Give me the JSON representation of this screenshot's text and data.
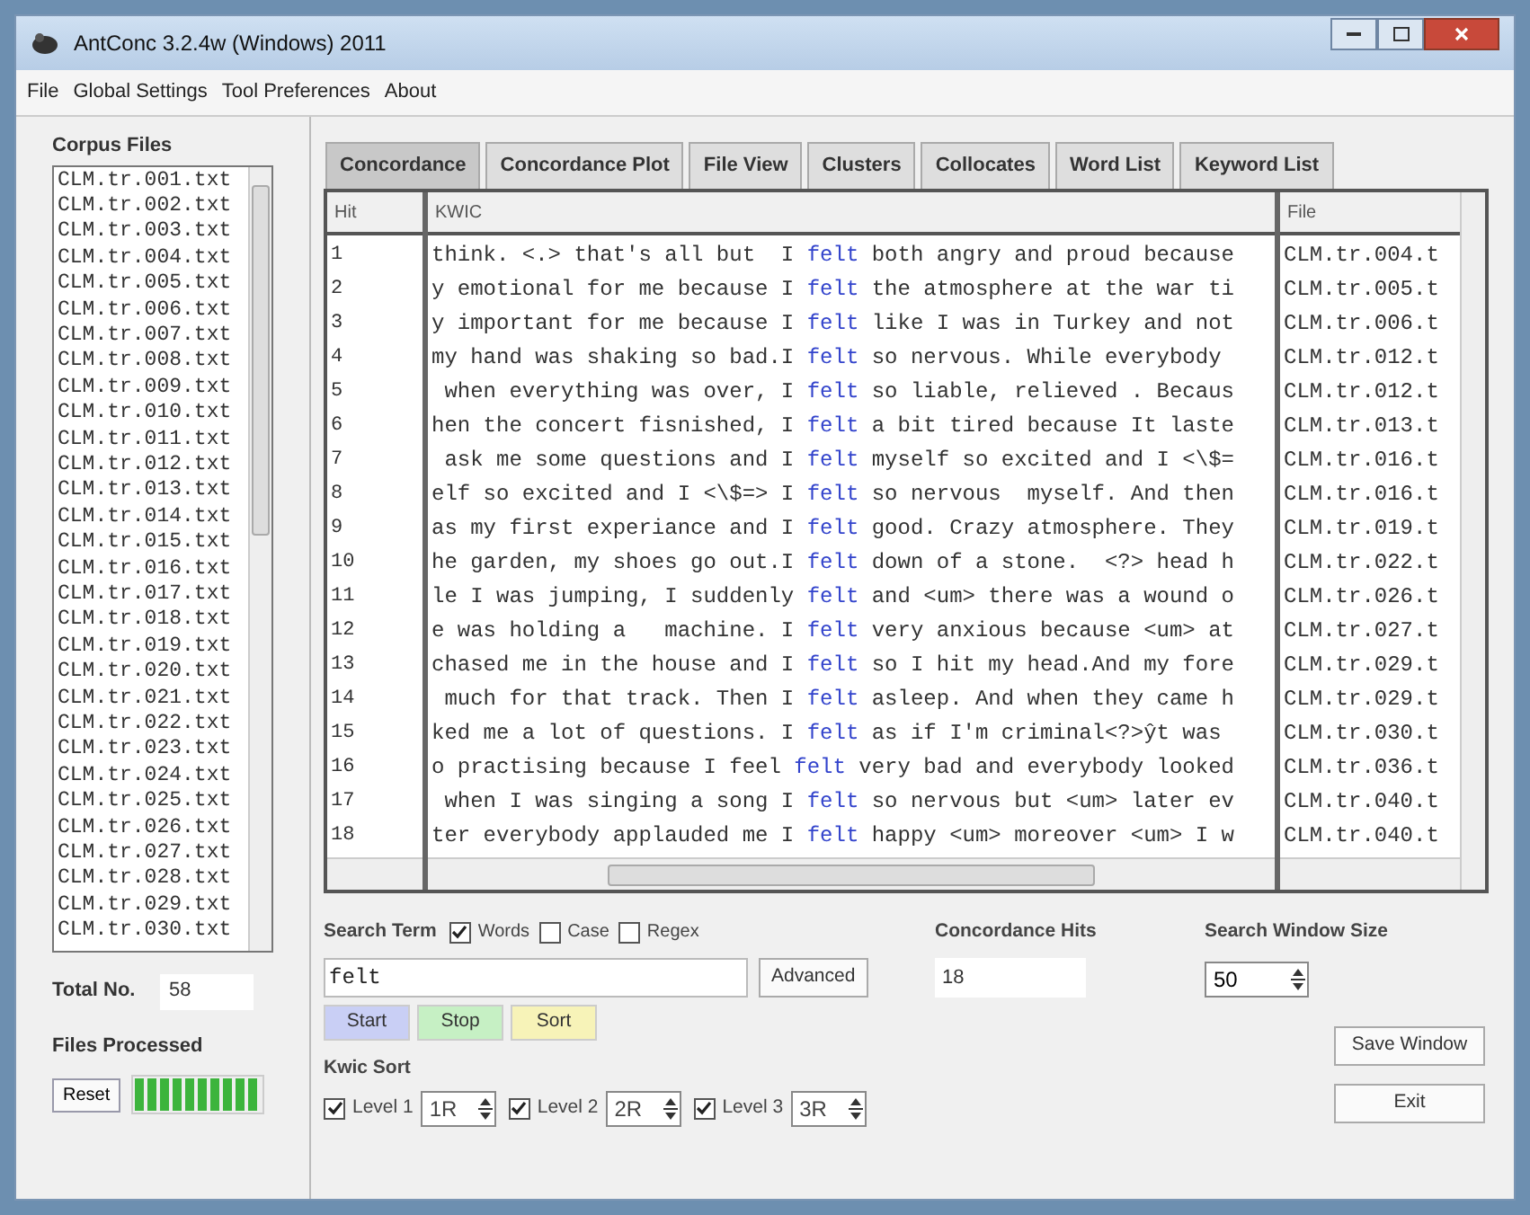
{
  "window": {
    "title": "AntConc 3.2.4w (Windows) 2011"
  },
  "menu": [
    "File",
    "Global Settings",
    "Tool Preferences",
    "About"
  ],
  "sidebar": {
    "title": "Corpus Files",
    "files": [
      "CLM.tr.001.txt",
      "CLM.tr.002.txt",
      "CLM.tr.003.txt",
      "CLM.tr.004.txt",
      "CLM.tr.005.txt",
      "CLM.tr.006.txt",
      "CLM.tr.007.txt",
      "CLM.tr.008.txt",
      "CLM.tr.009.txt",
      "CLM.tr.010.txt",
      "CLM.tr.011.txt",
      "CLM.tr.012.txt",
      "CLM.tr.013.txt",
      "CLM.tr.014.txt",
      "CLM.tr.015.txt",
      "CLM.tr.016.txt",
      "CLM.tr.017.txt",
      "CLM.tr.018.txt",
      "CLM.tr.019.txt",
      "CLM.tr.020.txt",
      "CLM.tr.021.txt",
      "CLM.tr.022.txt",
      "CLM.tr.023.txt",
      "CLM.tr.024.txt",
      "CLM.tr.025.txt",
      "CLM.tr.026.txt",
      "CLM.tr.027.txt",
      "CLM.tr.028.txt",
      "CLM.tr.029.txt",
      "CLM.tr.030.txt"
    ],
    "total_label": "Total No.",
    "total": "58",
    "processed": {
      "label": "Files Processed",
      "level": 1
    },
    "reset": "Reset"
  },
  "tabs": [
    {
      "label": "Concordance",
      "selected": true
    },
    {
      "label": "Concordance Plot",
      "selected": false
    },
    {
      "label": "File View",
      "selected": false
    },
    {
      "label": "Clusters",
      "selected": false
    },
    {
      "label": "Collocates",
      "selected": false
    },
    {
      "label": "Word List",
      "selected": false
    },
    {
      "label": "Keyword List",
      "selected": false
    }
  ],
  "table": {
    "columns": [
      "Hit",
      "KWIC",
      "File"
    ],
    "rows": [
      {
        "hit": "1",
        "left": "think. <.> that's all but  I ",
        "key": "felt",
        "right": " both angry and proud because",
        "file": "CLM.tr.004.t"
      },
      {
        "hit": "2",
        "left": "y emotional for me because I ",
        "key": "felt",
        "right": " the atmosphere at the war ti",
        "file": "CLM.tr.005.t"
      },
      {
        "hit": "3",
        "left": "y important for me because I ",
        "key": "felt",
        "right": " like I was in Turkey and not",
        "file": "CLM.tr.006.t"
      },
      {
        "hit": "4",
        "left": "my hand was shaking so bad.I ",
        "key": "felt",
        "right": " so nervous. While everybody",
        "file": "CLM.tr.012.t"
      },
      {
        "hit": "5",
        "left": " when everything was over, I ",
        "key": "felt",
        "right": " so liable, relieved . Becaus",
        "file": "CLM.tr.012.t"
      },
      {
        "hit": "6",
        "left": "hen the concert fisnished, I ",
        "key": "felt",
        "right": " a bit tired because It laste",
        "file": "CLM.tr.013.t"
      },
      {
        "hit": "7",
        "left": " ask me some questions and I ",
        "key": "felt",
        "right": " myself so excited and I <\\$=",
        "file": "CLM.tr.016.t"
      },
      {
        "hit": "8",
        "left": "elf so excited and I <\\$=> I ",
        "key": "felt",
        "right": " so nervous  myself. And then",
        "file": "CLM.tr.016.t"
      },
      {
        "hit": "9",
        "left": "as my first experiance and I ",
        "key": "felt",
        "right": " good. Crazy atmosphere. They",
        "file": "CLM.tr.019.t"
      },
      {
        "hit": "10",
        "left": "he garden, my shoes go out.I ",
        "key": "felt",
        "right": " down of a stone.  <?> head h",
        "file": "CLM.tr.022.t"
      },
      {
        "hit": "11",
        "left": "le I was jumping, I suddenly ",
        "key": "felt",
        "right": " and <um> there was a wound o",
        "file": "CLM.tr.026.t"
      },
      {
        "hit": "12",
        "left": "e was holding a   machine. I ",
        "key": "felt",
        "right": " very anxious because <um> at",
        "file": "CLM.tr.027.t"
      },
      {
        "hit": "13",
        "left": "chased me in the house and I ",
        "key": "felt",
        "right": " so I hit my head.And my fore",
        "file": "CLM.tr.029.t"
      },
      {
        "hit": "14",
        "left": " much for that track. Then I ",
        "key": "felt",
        "right": " asleep. And when they came h",
        "file": "CLM.tr.029.t"
      },
      {
        "hit": "15",
        "left": "ked me a lot of questions. I ",
        "key": "felt",
        "right": " as if I'm criminal<?>ŷt was",
        "file": "CLM.tr.030.t"
      },
      {
        "hit": "16",
        "left": "o practising because I feel ",
        "key": "felt",
        "right": " very bad and everybody looked",
        "file": "CLM.tr.036.t"
      },
      {
        "hit": "17",
        "left": " when I was singing a song I ",
        "key": "felt",
        "right": " so nervous but <um> later ev",
        "file": "CLM.tr.040.t"
      },
      {
        "hit": "18",
        "left": "ter everybody applauded me I ",
        "key": "felt",
        "right": " happy <um> moreover <um> I w",
        "file": "CLM.tr.040.t"
      }
    ]
  },
  "search": {
    "label": "Search Term",
    "options": [
      {
        "label": "Words",
        "checked": true
      },
      {
        "label": "Case",
        "checked": false
      },
      {
        "label": "Regex",
        "checked": false
      }
    ],
    "value": "felt",
    "advanced": "Advanced",
    "buttons": [
      {
        "label": "Start",
        "kind": "start"
      },
      {
        "label": "Stop",
        "kind": "stop"
      },
      {
        "label": "Sort",
        "kind": "sort"
      }
    ]
  },
  "hits": {
    "label": "Concordance Hits",
    "value": "18"
  },
  "window_size": {
    "label": "Search Window Size",
    "value": "50"
  },
  "kwic_sort": {
    "label": "Kwic Sort",
    "levels": [
      {
        "label": "Level 1",
        "checked": true,
        "value": "1R"
      },
      {
        "label": "Level 2",
        "checked": true,
        "value": "2R"
      },
      {
        "label": "Level 3",
        "checked": true,
        "value": "3R"
      }
    ]
  },
  "actions": [
    "Save Window",
    "Exit"
  ]
}
